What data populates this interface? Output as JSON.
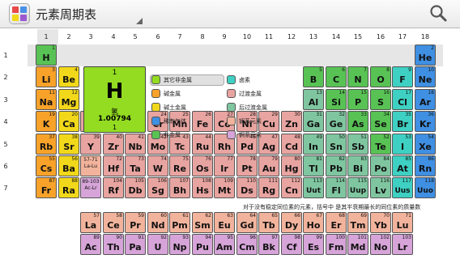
{
  "app": {
    "title": "元素周期表",
    "search_icon": "magnifier"
  },
  "group_numbers": [
    "1",
    "2",
    "3",
    "4",
    "5",
    "6",
    "7",
    "8",
    "9",
    "10",
    "11",
    "12",
    "13",
    "14",
    "15",
    "16",
    "17",
    "18"
  ],
  "period_numbers": [
    "1",
    "2",
    "3",
    "4",
    "5",
    "6",
    "7"
  ],
  "selected": {
    "number": "1",
    "symbol": "H",
    "name": "氢",
    "mass": "1.00794",
    "val": "1"
  },
  "legend": [
    {
      "label": "其它非金属",
      "color": "#93dc21"
    },
    {
      "label": "卤素",
      "color": "#3ed0c2"
    },
    {
      "label": "碱金属",
      "color": "#f8a22a"
    },
    {
      "label": "过渡金属",
      "color": "#e8a4a0"
    },
    {
      "label": "碱土金属",
      "color": "#f2d81a"
    },
    {
      "label": "后过渡金属",
      "color": "#7fc6a0"
    },
    {
      "label": "稀有气体",
      "color": "#3f8fe2"
    },
    {
      "label": "镧系元素",
      "color": "#f2b39c"
    },
    {
      "label": "非金属",
      "color": "#58c254"
    },
    {
      "label": "锕系元素",
      "color": "#d6a4d8"
    }
  ],
  "footnote": "对于没有稳定同位素的元素，括号中 是其半衰期最长的同位素的质量数",
  "placeholders": [
    {
      "num": "57-71",
      "label": "La-Lu",
      "color": "#f2b39c"
    },
    {
      "num": "89-103",
      "label": "Ac-Lr",
      "color": "#d6a4d8"
    }
  ],
  "elements": [
    [
      "1",
      "H",
      1,
      1,
      "n"
    ],
    [
      "2",
      "He",
      18,
      1,
      "g"
    ],
    [
      "3",
      "Li",
      1,
      2,
      "a"
    ],
    [
      "4",
      "Be",
      2,
      2,
      "e"
    ],
    [
      "5",
      "B",
      13,
      2,
      "n"
    ],
    [
      "6",
      "C",
      14,
      2,
      "n"
    ],
    [
      "7",
      "N",
      15,
      2,
      "n"
    ],
    [
      "8",
      "O",
      16,
      2,
      "n"
    ],
    [
      "9",
      "F",
      17,
      2,
      "h"
    ],
    [
      "10",
      "Ne",
      18,
      2,
      "g"
    ],
    [
      "11",
      "Na",
      1,
      3,
      "a"
    ],
    [
      "12",
      "Mg",
      2,
      3,
      "e"
    ],
    [
      "13",
      "Al",
      13,
      3,
      "p"
    ],
    [
      "14",
      "Si",
      14,
      3,
      "n"
    ],
    [
      "15",
      "P",
      15,
      3,
      "n"
    ],
    [
      "16",
      "S",
      16,
      3,
      "n"
    ],
    [
      "17",
      "Cl",
      17,
      3,
      "h"
    ],
    [
      "18",
      "Ar",
      18,
      3,
      "g"
    ],
    [
      "19",
      "K",
      1,
      4,
      "a"
    ],
    [
      "20",
      "Ca",
      2,
      4,
      "e"
    ],
    [
      "21",
      "Sc",
      3,
      4,
      "t"
    ],
    [
      "22",
      "Ti",
      4,
      4,
      "t"
    ],
    [
      "23",
      "V",
      5,
      4,
      "t"
    ],
    [
      "24",
      "Cr",
      6,
      4,
      "t"
    ],
    [
      "25",
      "Mn",
      7,
      4,
      "t"
    ],
    [
      "26",
      "Fe",
      8,
      4,
      "t"
    ],
    [
      "27",
      "Co",
      9,
      4,
      "t"
    ],
    [
      "28",
      "Ni",
      10,
      4,
      "t"
    ],
    [
      "29",
      "Cu",
      11,
      4,
      "t"
    ],
    [
      "30",
      "Zn",
      12,
      4,
      "t"
    ],
    [
      "31",
      "Ga",
      13,
      4,
      "p"
    ],
    [
      "32",
      "Ge",
      14,
      4,
      "p"
    ],
    [
      "33",
      "As",
      15,
      4,
      "n"
    ],
    [
      "34",
      "Se",
      16,
      4,
      "n"
    ],
    [
      "35",
      "Br",
      17,
      4,
      "h"
    ],
    [
      "36",
      "Kr",
      18,
      4,
      "g"
    ],
    [
      "37",
      "Rb",
      1,
      5,
      "a"
    ],
    [
      "38",
      "Sr",
      2,
      5,
      "e"
    ],
    [
      "39",
      "Y",
      3,
      5,
      "t"
    ],
    [
      "40",
      "Zr",
      4,
      5,
      "t"
    ],
    [
      "41",
      "Nb",
      5,
      5,
      "t"
    ],
    [
      "42",
      "Mo",
      6,
      5,
      "t"
    ],
    [
      "43",
      "Tc",
      7,
      5,
      "t"
    ],
    [
      "44",
      "Ru",
      8,
      5,
      "t"
    ],
    [
      "45",
      "Rh",
      9,
      5,
      "t"
    ],
    [
      "46",
      "Pd",
      10,
      5,
      "t"
    ],
    [
      "47",
      "Ag",
      11,
      5,
      "t"
    ],
    [
      "48",
      "Cd",
      12,
      5,
      "t"
    ],
    [
      "49",
      "In",
      13,
      5,
      "p"
    ],
    [
      "50",
      "Sn",
      14,
      5,
      "p"
    ],
    [
      "51",
      "Sb",
      15,
      5,
      "p"
    ],
    [
      "52",
      "Te",
      16,
      5,
      "n"
    ],
    [
      "53",
      "I",
      17,
      5,
      "h"
    ],
    [
      "54",
      "Xe",
      18,
      5,
      "g"
    ],
    [
      "55",
      "Cs",
      1,
      6,
      "a"
    ],
    [
      "56",
      "Ba",
      2,
      6,
      "e"
    ],
    [
      "72",
      "Hf",
      4,
      6,
      "t"
    ],
    [
      "73",
      "Ta",
      5,
      6,
      "t"
    ],
    [
      "74",
      "W",
      6,
      6,
      "t"
    ],
    [
      "75",
      "Re",
      7,
      6,
      "t"
    ],
    [
      "76",
      "Os",
      8,
      6,
      "t"
    ],
    [
      "77",
      "Ir",
      9,
      6,
      "t"
    ],
    [
      "78",
      "Pt",
      10,
      6,
      "t"
    ],
    [
      "79",
      "Au",
      11,
      6,
      "t"
    ],
    [
      "80",
      "Hg",
      12,
      6,
      "t"
    ],
    [
      "81",
      "Tl",
      13,
      6,
      "p"
    ],
    [
      "82",
      "Pb",
      14,
      6,
      "p"
    ],
    [
      "83",
      "Bi",
      15,
      6,
      "p"
    ],
    [
      "84",
      "Po",
      16,
      6,
      "p"
    ],
    [
      "85",
      "At",
      17,
      6,
      "h"
    ],
    [
      "86",
      "Rn",
      18,
      6,
      "g"
    ],
    [
      "87",
      "Fr",
      1,
      7,
      "a"
    ],
    [
      "88",
      "Ra",
      2,
      7,
      "e"
    ],
    [
      "104",
      "Rf",
      4,
      7,
      "t"
    ],
    [
      "105",
      "Db",
      5,
      7,
      "t"
    ],
    [
      "106",
      "Sg",
      6,
      7,
      "t"
    ],
    [
      "107",
      "Bh",
      7,
      7,
      "t"
    ],
    [
      "108",
      "Hs",
      8,
      7,
      "t"
    ],
    [
      "109",
      "Mt",
      9,
      7,
      "t"
    ],
    [
      "110",
      "Ds",
      10,
      7,
      "t"
    ],
    [
      "111",
      "Rg",
      11,
      7,
      "t"
    ],
    [
      "112",
      "Cn",
      12,
      7,
      "t"
    ],
    [
      "113",
      "Uut",
      13,
      7,
      "p"
    ],
    [
      "114",
      "Fl",
      14,
      7,
      "p"
    ],
    [
      "115",
      "Uup",
      15,
      7,
      "p"
    ],
    [
      "116",
      "Lv",
      16,
      7,
      "p"
    ],
    [
      "117",
      "Uus",
      17,
      7,
      "h"
    ],
    [
      "118",
      "Uuo",
      18,
      7,
      "g"
    ],
    [
      "57",
      "La",
      3,
      9,
      "l"
    ],
    [
      "58",
      "Ce",
      4,
      9,
      "l"
    ],
    [
      "59",
      "Pr",
      5,
      9,
      "l"
    ],
    [
      "60",
      "Nd",
      6,
      9,
      "l"
    ],
    [
      "61",
      "Pm",
      7,
      9,
      "l"
    ],
    [
      "62",
      "Sm",
      8,
      9,
      "l"
    ],
    [
      "63",
      "Eu",
      9,
      9,
      "l"
    ],
    [
      "64",
      "Gd",
      10,
      9,
      "l"
    ],
    [
      "65",
      "Tb",
      11,
      9,
      "l"
    ],
    [
      "66",
      "Dy",
      12,
      9,
      "l"
    ],
    [
      "67",
      "Ho",
      13,
      9,
      "l"
    ],
    [
      "68",
      "Er",
      14,
      9,
      "l"
    ],
    [
      "69",
      "Tm",
      15,
      9,
      "l"
    ],
    [
      "70",
      "Yb",
      16,
      9,
      "l"
    ],
    [
      "71",
      "Lu",
      17,
      9,
      "l"
    ],
    [
      "89",
      "Ac",
      3,
      10,
      "c"
    ],
    [
      "90",
      "Th",
      4,
      10,
      "c"
    ],
    [
      "91",
      "Pa",
      5,
      10,
      "c"
    ],
    [
      "92",
      "U",
      6,
      10,
      "c"
    ],
    [
      "93",
      "Np",
      7,
      10,
      "c"
    ],
    [
      "94",
      "Pu",
      8,
      10,
      "c"
    ],
    [
      "95",
      "Am",
      9,
      10,
      "c"
    ],
    [
      "96",
      "Cm",
      10,
      10,
      "c"
    ],
    [
      "97",
      "Bk",
      11,
      10,
      "c"
    ],
    [
      "98",
      "Cf",
      12,
      10,
      "c"
    ],
    [
      "99",
      "Es",
      13,
      10,
      "c"
    ],
    [
      "100",
      "Fm",
      14,
      10,
      "c"
    ],
    [
      "101",
      "Md",
      15,
      10,
      "c"
    ],
    [
      "102",
      "No",
      16,
      10,
      "c"
    ],
    [
      "103",
      "Lr",
      17,
      10,
      "c"
    ]
  ],
  "category_colors": {
    "n": "#58c254",
    "g": "#3f8fe2",
    "h": "#3ed0c2",
    "a": "#f8a22a",
    "e": "#f2d81a",
    "t": "#e8a4a0",
    "p": "#7fc6a0",
    "l": "#f2b39c",
    "c": "#d6a4d8"
  }
}
